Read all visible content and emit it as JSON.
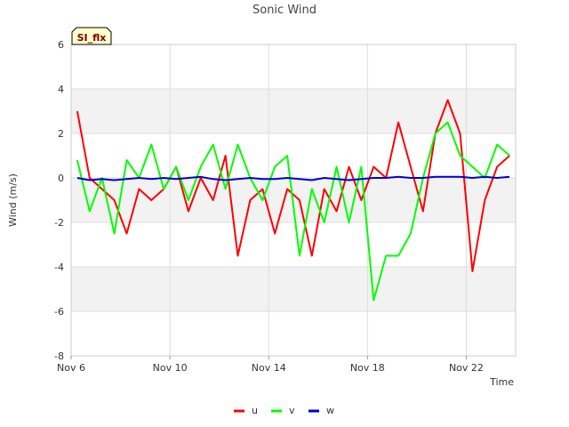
{
  "chart_data": {
    "type": "line",
    "title": "Sonic Wind",
    "xlabel": "Time",
    "ylabel": "Wind (m/s)",
    "badge": "SI_flx",
    "xlim": [
      "2023-11-06",
      "2023-11-24"
    ],
    "ylim": [
      -8,
      6
    ],
    "x_ticks": [
      {
        "date": "2023-11-06",
        "label": "Nov 6"
      },
      {
        "date": "2023-11-10",
        "label": "Nov 10"
      },
      {
        "date": "2023-11-14",
        "label": "Nov 14"
      },
      {
        "date": "2023-11-18",
        "label": "Nov 18"
      },
      {
        "date": "2023-11-22",
        "label": "Nov 22"
      }
    ],
    "y_ticks": [
      6,
      4,
      2,
      0,
      -2,
      -4,
      -6,
      -8
    ],
    "grid": true,
    "banded_background": true,
    "legend_position": "bottom-center",
    "x": [
      "2023-11-06 06:00",
      "2023-11-06 18:00",
      "2023-11-07 06:00",
      "2023-11-07 18:00",
      "2023-11-08 06:00",
      "2023-11-08 18:00",
      "2023-11-09 06:00",
      "2023-11-09 18:00",
      "2023-11-10 06:00",
      "2023-11-10 18:00",
      "2023-11-11 06:00",
      "2023-11-11 18:00",
      "2023-11-12 06:00",
      "2023-11-12 18:00",
      "2023-11-13 06:00",
      "2023-11-13 18:00",
      "2023-11-14 06:00",
      "2023-11-14 18:00",
      "2023-11-15 06:00",
      "2023-11-15 18:00",
      "2023-11-16 06:00",
      "2023-11-16 18:00",
      "2023-11-17 06:00",
      "2023-11-17 18:00",
      "2023-11-18 06:00",
      "2023-11-18 18:00",
      "2023-11-19 06:00",
      "2023-11-19 18:00",
      "2023-11-20 06:00",
      "2023-11-20 18:00",
      "2023-11-21 06:00",
      "2023-11-21 18:00",
      "2023-11-22 06:00",
      "2023-11-22 18:00",
      "2023-11-23 06:00",
      "2023-11-23 18:00"
    ],
    "series": [
      {
        "name": "u",
        "color": "#ff0000",
        "values": [
          3.0,
          0.0,
          -0.5,
          -1.0,
          -2.5,
          -0.5,
          -1.0,
          -0.5,
          0.5,
          -1.5,
          0.0,
          -1.0,
          1.0,
          -3.5,
          -1.0,
          -0.5,
          -2.5,
          -0.5,
          -1.0,
          -3.5,
          -0.5,
          -1.5,
          0.5,
          -1.0,
          0.5,
          0.0,
          2.5,
          0.5,
          -1.5,
          2.0,
          3.5,
          2.0,
          -4.2,
          -1.0,
          0.5,
          1.0
        ]
      },
      {
        "name": "v",
        "color": "#00ff00",
        "values": [
          0.8,
          -1.5,
          0.0,
          -2.5,
          0.8,
          0.0,
          1.5,
          -0.5,
          0.5,
          -1.0,
          0.5,
          1.5,
          -0.5,
          1.5,
          0.0,
          -1.0,
          0.5,
          1.0,
          -3.5,
          -0.5,
          -2.0,
          0.5,
          -2.0,
          0.5,
          -5.5,
          -3.5,
          -3.5,
          -2.5,
          0.0,
          2.0,
          2.5,
          1.0,
          0.5,
          0.0,
          1.5,
          1.0
        ]
      },
      {
        "name": "w",
        "color": "#0000cc",
        "values": [
          0.0,
          -0.1,
          -0.05,
          -0.1,
          -0.05,
          0.0,
          -0.05,
          0.0,
          -0.05,
          0.0,
          0.05,
          -0.05,
          -0.1,
          -0.05,
          0.0,
          -0.05,
          -0.05,
          0.0,
          -0.05,
          -0.1,
          0.0,
          -0.05,
          -0.1,
          -0.05,
          0.0,
          0.0,
          0.05,
          0.0,
          0.0,
          0.05,
          0.05,
          0.05,
          0.0,
          0.05,
          0.0,
          0.05
        ]
      }
    ]
  }
}
